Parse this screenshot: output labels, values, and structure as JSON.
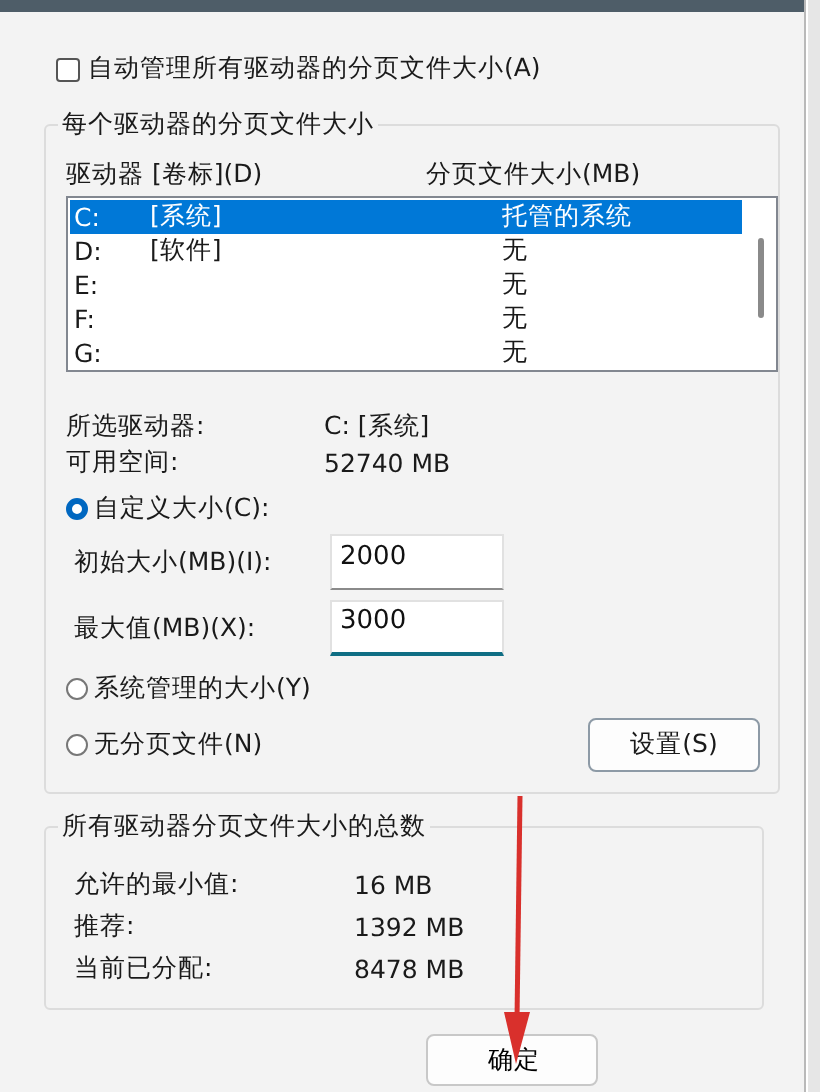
{
  "auto_manage": {
    "label": "自动管理所有驱动器的分页文件大小(A)",
    "checked": false
  },
  "per_drive": {
    "title": "每个驱动器的分页文件大小",
    "columns": [
      "驱动器 [卷标](D)",
      "分页文件大小(MB)"
    ],
    "drives": [
      {
        "drive": "C:",
        "volume": "[系统]",
        "paging_size": "托管的系统",
        "selected": true
      },
      {
        "drive": "D:",
        "volume": "[软件]",
        "paging_size": "无",
        "selected": false
      },
      {
        "drive": "E:",
        "paging_size": "无",
        "selected": false
      },
      {
        "drive": "F:",
        "paging_size": "无",
        "selected": false
      },
      {
        "drive": "G:",
        "paging_size": "无",
        "selected": false
      }
    ],
    "info": [
      {
        "label": "所选驱动器:",
        "value": "C:  [系统]"
      },
      {
        "label": "可用空间:",
        "value": "52740 MB"
      }
    ],
    "options": [
      {
        "label": "自定义大小(C):",
        "selected": true,
        "fields": [
          {
            "label": "初始大小(MB)(I):",
            "value": "2000",
            "focused": false
          },
          {
            "label": "最大值(MB)(X):",
            "value": "3000",
            "focused": true
          }
        ]
      },
      {
        "label": "系统管理的大小(Y)",
        "selected": false
      },
      {
        "label": "无分页文件(N)",
        "selected": false
      }
    ],
    "set_button": "设置(S)"
  },
  "totals": {
    "title": "所有驱动器分页文件大小的总数",
    "rows": [
      {
        "label": "允许的最小值:",
        "value": "16 MB"
      },
      {
        "label": "推荐:",
        "value": "1392 MB"
      },
      {
        "label": "当前已分配:",
        "value": "8478 MB"
      }
    ]
  },
  "buttons": [
    "确定"
  ]
}
